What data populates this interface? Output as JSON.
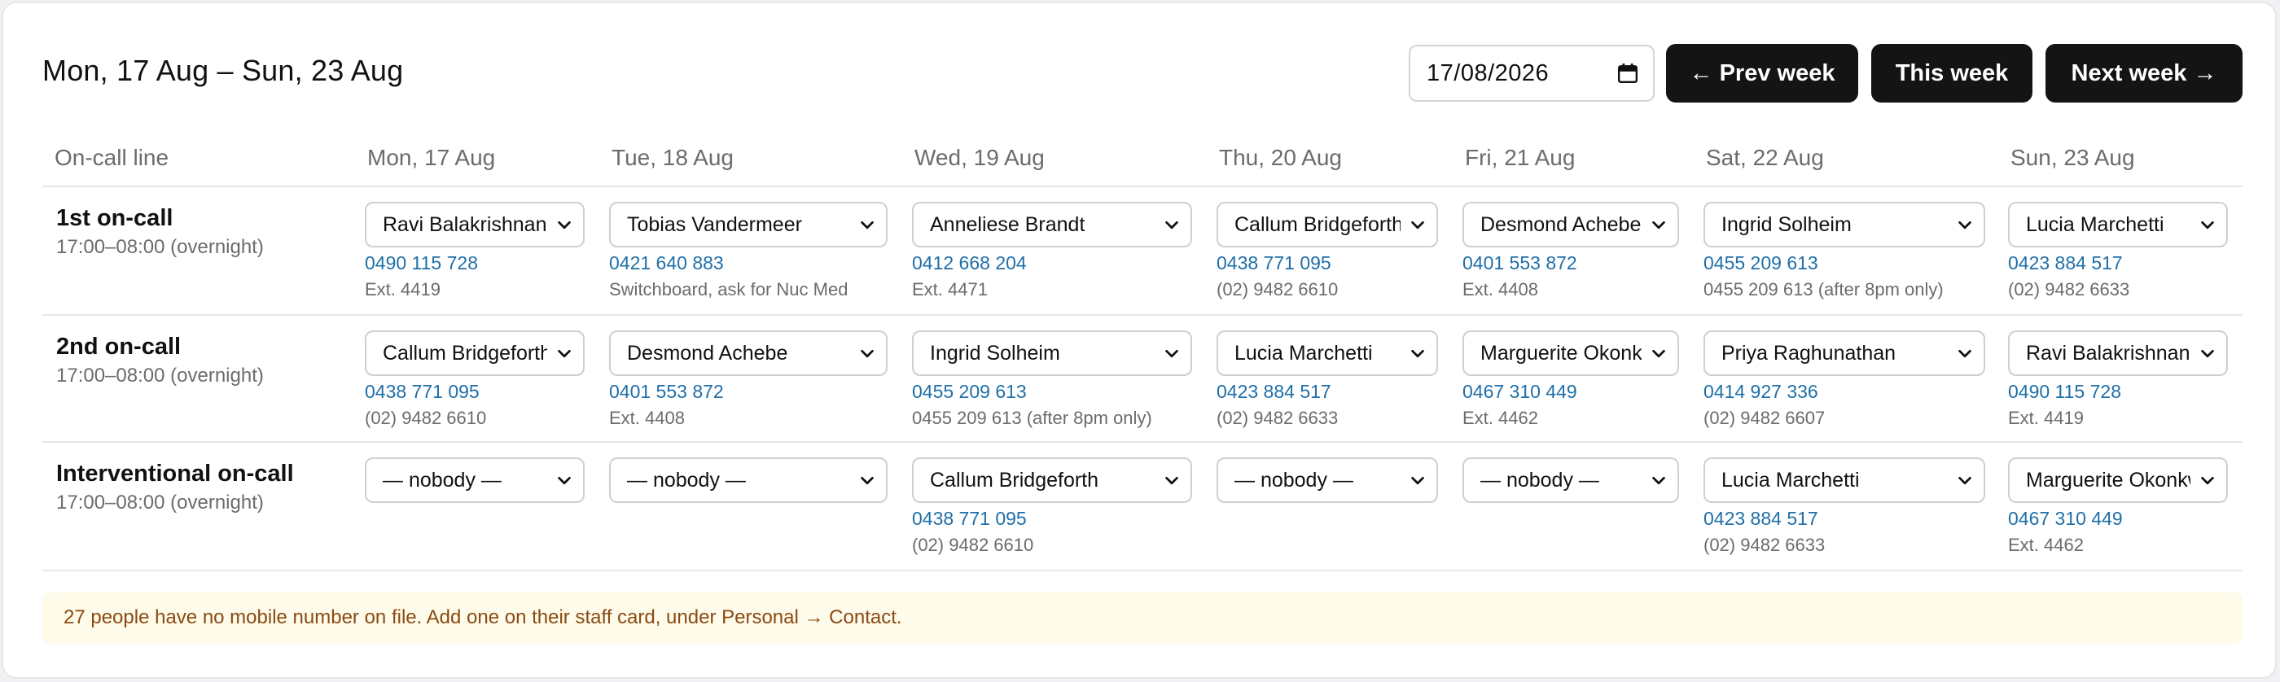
{
  "header": {
    "range": "Mon, 17 Aug – Sun, 23 Aug",
    "date_value": "17/08/2026",
    "prev_label": "← Prev week",
    "this_label": "This week",
    "next_label": "Next week →"
  },
  "table": {
    "line_header": "On-call line",
    "days": [
      "Mon, 17 Aug",
      "Tue, 18 Aug",
      "Wed, 19 Aug",
      "Thu, 20 Aug",
      "Fri, 21 Aug",
      "Sat, 22 Aug",
      "Sun, 23 Aug"
    ],
    "rows": [
      {
        "name": "1st on-call",
        "hours": "17:00–08:00 (overnight)",
        "cells": [
          {
            "person": "Ravi Balakrishnan",
            "phone": "0490 115 728",
            "note": "Ext. 4419"
          },
          {
            "person": "Tobias Vandermeer",
            "phone": "0421 640 883",
            "note": "Switchboard, ask for Nuc Med"
          },
          {
            "person": "Anneliese Brandt",
            "phone": "0412 668 204",
            "note": "Ext. 4471"
          },
          {
            "person": "Callum Bridgeforth",
            "phone": "0438 771 095",
            "note": "(02) 9482 6610"
          },
          {
            "person": "Desmond Achebe",
            "phone": "0401 553 872",
            "note": "Ext. 4408"
          },
          {
            "person": "Ingrid Solheim",
            "phone": "0455 209 613",
            "note": "0455 209 613 (after 8pm only)"
          },
          {
            "person": "Lucia Marchetti",
            "phone": "0423 884 517",
            "note": "(02) 9482 6633"
          }
        ]
      },
      {
        "name": "2nd on-call",
        "hours": "17:00–08:00 (overnight)",
        "cells": [
          {
            "person": "Callum Bridgeforth",
            "phone": "0438 771 095",
            "note": "(02) 9482 6610"
          },
          {
            "person": "Desmond Achebe",
            "phone": "0401 553 872",
            "note": "Ext. 4408"
          },
          {
            "person": "Ingrid Solheim",
            "phone": "0455 209 613",
            "note": "0455 209 613 (after 8pm only)"
          },
          {
            "person": "Lucia Marchetti",
            "phone": "0423 884 517",
            "note": "(02) 9482 6633"
          },
          {
            "person": "Marguerite Okonkwo",
            "phone": "0467 310 449",
            "note": "Ext. 4462"
          },
          {
            "person": "Priya Raghunathan",
            "phone": "0414 927 336",
            "note": "(02) 9482 6607"
          },
          {
            "person": "Ravi Balakrishnan",
            "phone": "0490 115 728",
            "note": "Ext. 4419"
          }
        ]
      },
      {
        "name": "Interventional on-call",
        "hours": "17:00–08:00 (overnight)",
        "cells": [
          {
            "person": "— nobody —",
            "phone": null,
            "note": null
          },
          {
            "person": "— nobody —",
            "phone": null,
            "note": null
          },
          {
            "person": "Callum Bridgeforth",
            "phone": "0438 771 095",
            "note": "(02) 9482 6610"
          },
          {
            "person": "— nobody —",
            "phone": null,
            "note": null
          },
          {
            "person": "— nobody —",
            "phone": null,
            "note": null
          },
          {
            "person": "Lucia Marchetti",
            "phone": "0423 884 517",
            "note": "(02) 9482 6633"
          },
          {
            "person": "Marguerite Okonkwo",
            "phone": "0467 310 449",
            "note": "Ext. 4462"
          }
        ]
      }
    ]
  },
  "notice": "27 people have no mobile number on file. Add one on their staff card, under Personal → Contact.",
  "colors": {
    "accent_link": "#1f6fa8",
    "button_bg": "#141414",
    "notice_bg": "#fefbea",
    "notice_text": "#8a4a12"
  },
  "icons": {
    "date_picker": "calendar-icon",
    "select": "chevron-down-icon"
  }
}
